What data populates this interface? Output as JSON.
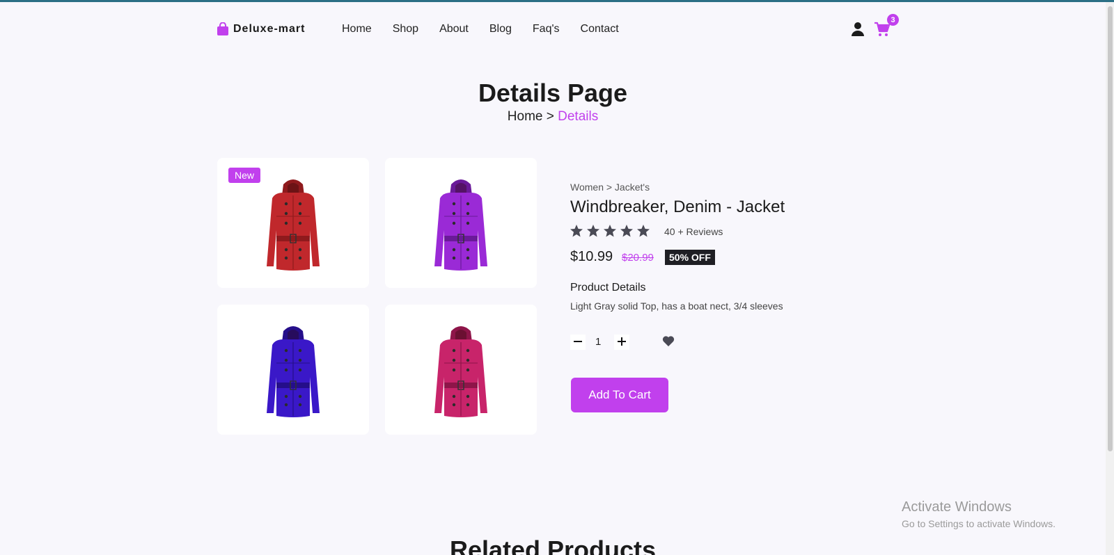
{
  "brand": {
    "name": "Deluxe-mart",
    "accent": "#c140ed"
  },
  "nav": {
    "items": [
      "Home",
      "Shop",
      "About",
      "Blog",
      "Faq's",
      "Contact"
    ]
  },
  "header": {
    "cart_count": "3"
  },
  "page": {
    "title": "Details Page",
    "breadcrumb": {
      "home": "Home",
      "separator": " > ",
      "current": "Details"
    }
  },
  "gallery": {
    "badge": "New",
    "jackets": [
      {
        "color": "#c0282c",
        "dark": "#8f1a1d"
      },
      {
        "color": "#9a2ad6",
        "dark": "#6a1a99"
      },
      {
        "color": "#3a18c8",
        "dark": "#250e8a"
      },
      {
        "color": "#c8246a",
        "dark": "#8e1549"
      }
    ]
  },
  "product": {
    "category": "Women > Jacket's",
    "name": "Windbreaker, Denim - Jacket",
    "rating": 5,
    "reviews": "40 + Reviews",
    "price": "$10.99",
    "old_price": "$20.99",
    "discount": "50% OFF",
    "details_heading": "Product Details",
    "details_text": "Light Gray solid Top, has a boat nect, 3/4 sleeves",
    "quantity": "1",
    "add_to_cart": "Add To Cart"
  },
  "related": {
    "title": "Related Products"
  },
  "watermark": {
    "line1": "Activate Windows",
    "line2": "Go to Settings to activate Windows."
  }
}
